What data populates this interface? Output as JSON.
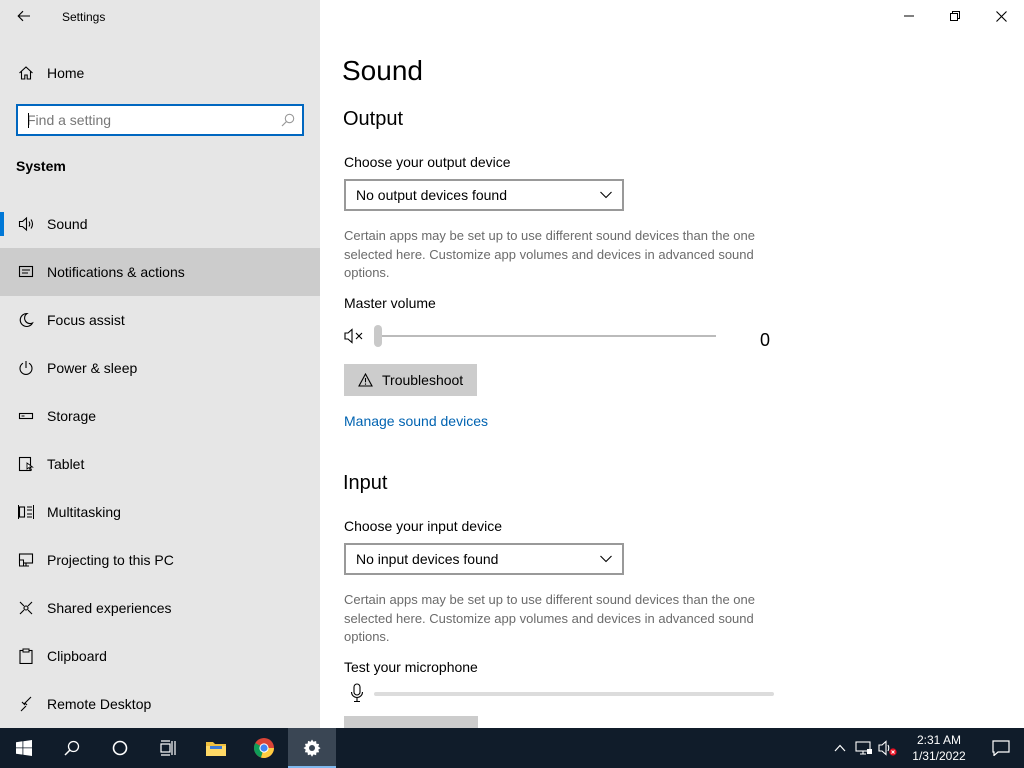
{
  "window": {
    "title": "Settings"
  },
  "sidebar": {
    "home_label": "Home",
    "search_placeholder": "Find a setting",
    "section_header": "System",
    "items": [
      {
        "label": "Sound",
        "icon": "speaker-icon"
      },
      {
        "label": "Notifications & actions",
        "icon": "notification-icon"
      },
      {
        "label": "Focus assist",
        "icon": "moon-icon"
      },
      {
        "label": "Power & sleep",
        "icon": "power-icon"
      },
      {
        "label": "Storage",
        "icon": "storage-icon"
      },
      {
        "label": "Tablet",
        "icon": "tablet-icon"
      },
      {
        "label": "Multitasking",
        "icon": "multitasking-icon"
      },
      {
        "label": "Projecting to this PC",
        "icon": "projecting-icon"
      },
      {
        "label": "Shared experiences",
        "icon": "shared-experiences-icon"
      },
      {
        "label": "Clipboard",
        "icon": "clipboard-icon"
      },
      {
        "label": "Remote Desktop",
        "icon": "remote-desktop-icon"
      }
    ]
  },
  "main": {
    "title": "Sound",
    "output": {
      "heading": "Output",
      "device_label": "Choose your output device",
      "device_value": "No output devices found",
      "description": "Certain apps may be set up to use different sound devices than the one selected here. Customize app volumes and devices in advanced sound options.",
      "volume_label": "Master volume",
      "volume_value": "0",
      "troubleshoot_label": "Troubleshoot",
      "manage_link": "Manage sound devices"
    },
    "input": {
      "heading": "Input",
      "device_label": "Choose your input device",
      "device_value": "No input devices found",
      "description": "Certain apps may be set up to use different sound devices than the one selected here. Customize app volumes and devices in advanced sound options.",
      "test_label": "Test your microphone"
    }
  },
  "taskbar": {
    "time": "2:31 AM",
    "date": "1/31/2022"
  },
  "colors": {
    "accent": "#0078d7",
    "link": "#0063b1",
    "sidebar_bg": "#e6e6e6",
    "taskbar_bg": "#101c2a"
  }
}
